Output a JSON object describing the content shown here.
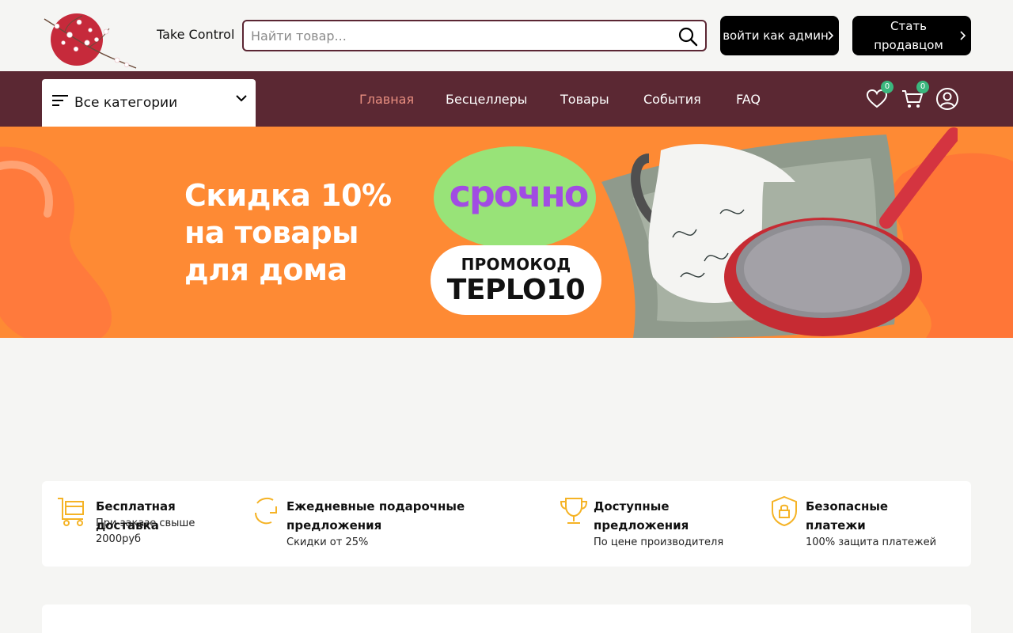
{
  "header": {
    "brand": "Take Control",
    "search": {
      "placeholder": "Найти товар...",
      "value": ""
    },
    "admin_button": "войти как админ",
    "seller_button": "Стать продавцом"
  },
  "nav": {
    "categories_label": "Все категории",
    "links": [
      {
        "label": "Главная",
        "active": true
      },
      {
        "label": "Бесцеллеры",
        "active": false
      },
      {
        "label": "Товары",
        "active": false
      },
      {
        "label": "События",
        "active": false
      },
      {
        "label": "FAQ",
        "active": false
      }
    ],
    "wishlist_count": "0",
    "cart_count": "0"
  },
  "hero": {
    "title_lines": [
      "Скидка 10%",
      "на товары",
      "для дома"
    ],
    "bubble_text": "срочно",
    "promo_label": "ПРОМОКОД",
    "promo_code": "TEPLO10"
  },
  "features": [
    {
      "icon": "cart-icon",
      "title": "Бесплатная доставка",
      "desc": "При заказе свыше 2000руб"
    },
    {
      "icon": "refresh-icon",
      "title": "Ежедневные подарочные предложения",
      "desc": "Скидки от 25%"
    },
    {
      "icon": "trophy-icon",
      "title": "Доступные предложения",
      "desc": "По цене производителя"
    },
    {
      "icon": "shield-lock-icon",
      "title": "Безопасные платежи",
      "desc": "100% защита платежей"
    }
  ],
  "colors": {
    "nav_bg": "#5b2833",
    "accent_active": "#e98f80",
    "hero_bg": "#fe8a34",
    "badge": "#3bb77e",
    "feature_icon": "#f5b326"
  }
}
